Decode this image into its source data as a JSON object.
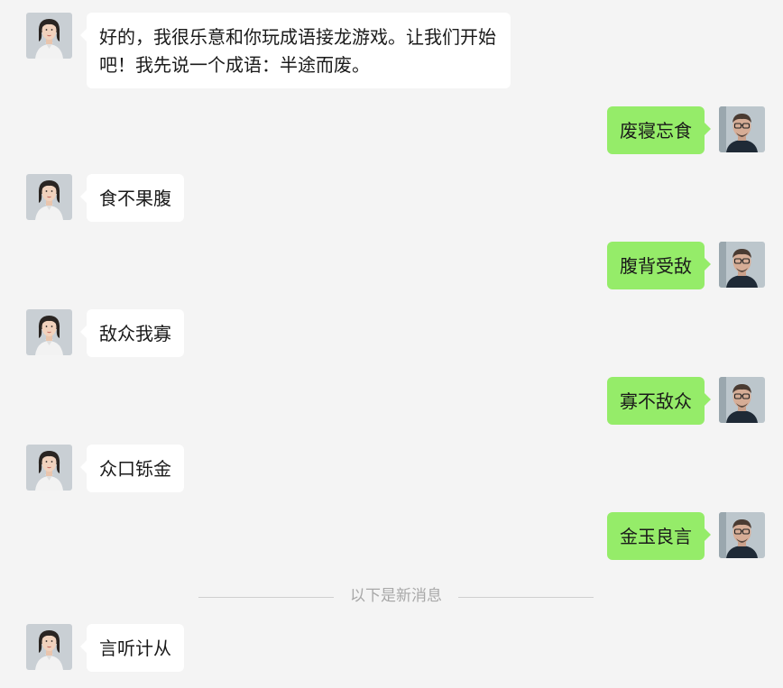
{
  "messages": [
    {
      "side": "left",
      "text": "好的，我很乐意和你玩成语接龙游戏。让我们开始吧！我先说一个成语：半途而废。"
    },
    {
      "side": "right",
      "text": "废寝忘食"
    },
    {
      "side": "left",
      "text": "食不果腹"
    },
    {
      "side": "right",
      "text": "腹背受敌"
    },
    {
      "side": "left",
      "text": "敌众我寡"
    },
    {
      "side": "right",
      "text": "寡不敌众"
    },
    {
      "side": "left",
      "text": "众口铄金"
    },
    {
      "side": "right",
      "text": "金玉良言"
    },
    {
      "side": "left",
      "text": "言听计从"
    }
  ],
  "divider": {
    "label": "以下是新消息"
  },
  "colors": {
    "background": "#f4f4f4",
    "incoming_bubble": "#ffffff",
    "outgoing_bubble": "#95ec69",
    "divider_text": "#a8a8a8"
  },
  "icons": {
    "incoming_avatar": "female-avatar-icon",
    "outgoing_avatar": "male-avatar-icon"
  }
}
